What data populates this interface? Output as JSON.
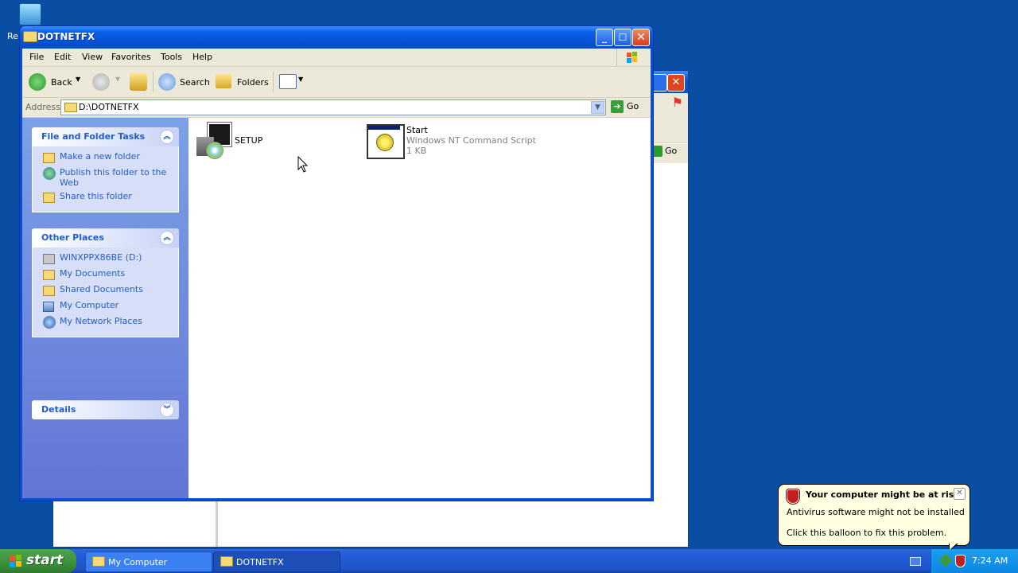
{
  "desktop": {
    "recycle_label": "Re"
  },
  "bg_window": {
    "go_label": "Go"
  },
  "window": {
    "title": "DOTNETFX",
    "menu": [
      "File",
      "Edit",
      "View",
      "Favorites",
      "Tools",
      "Help"
    ],
    "toolbar": {
      "back": "Back",
      "search": "Search",
      "folders": "Folders"
    },
    "address": {
      "label": "Address",
      "value": "D:\\DOTNETFX",
      "go": "Go"
    },
    "tasks_panel": {
      "title": "File and Folder Tasks",
      "items": [
        "Make a new folder",
        "Publish this folder to the Web",
        "Share this folder"
      ]
    },
    "places_panel": {
      "title": "Other Places",
      "items": [
        "WINXPPX86BE (D:)",
        "My Documents",
        "Shared Documents",
        "My Computer",
        "My Network Places"
      ]
    },
    "details_panel": {
      "title": "Details"
    },
    "files": [
      {
        "name": "SETUP"
      },
      {
        "name": "Start",
        "type": "Windows NT Command Script",
        "size": "1 KB"
      }
    ]
  },
  "taskbar": {
    "start": "start",
    "tasks": [
      "My Computer",
      "DOTNETFX"
    ],
    "clock": "7:24 AM"
  },
  "balloon": {
    "title": "Your computer might be at risk",
    "line1": "Antivirus software might not be installed",
    "line2": "Click this balloon to fix this problem."
  }
}
